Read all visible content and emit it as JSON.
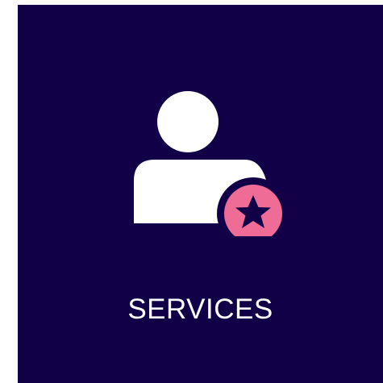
{
  "tile": {
    "label": "SERVICES",
    "background_color": "#110047",
    "icon": "user-star-icon",
    "icon_colors": {
      "figure": "#ffffff",
      "badge": "#ee6c95",
      "star": "#110047"
    }
  }
}
